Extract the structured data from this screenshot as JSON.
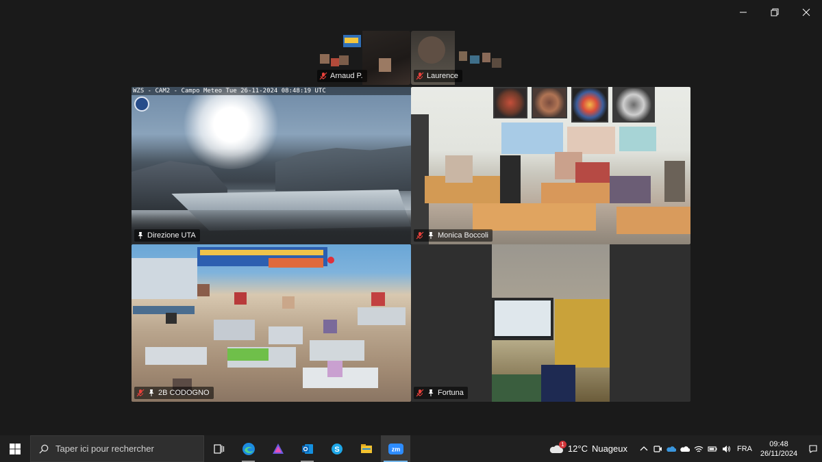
{
  "window": {
    "controls": [
      "minimize",
      "restore",
      "close"
    ]
  },
  "participants": {
    "strip": [
      {
        "name": "Arnaud P.",
        "muted": true
      },
      {
        "name": "Laurence",
        "muted": true
      }
    ],
    "grid": [
      {
        "name": "Direzione UTA",
        "muted": false,
        "pinned": true,
        "active_speaker": true,
        "overlay": "WZS - CAM2 - Campo Meteo Tue 26-11-2024 08:48:19 UTC"
      },
      {
        "name": "Monica Boccoli",
        "muted": true,
        "pinned": true
      },
      {
        "name": "2B CODOGNO",
        "muted": true,
        "pinned": true
      },
      {
        "name": "Fortuna",
        "muted": true,
        "pinned": true
      }
    ]
  },
  "taskbar": {
    "search_placeholder": "Taper ici pour rechercher",
    "apps": [
      "task-view",
      "edge",
      "copilot",
      "outlook",
      "skype",
      "file-explorer",
      "zoom"
    ],
    "weather": {
      "temp": "12°C",
      "condition": "Nuageux",
      "alert_badge": "1"
    },
    "language": "FRA",
    "time": "09:48",
    "date": "26/11/2024"
  },
  "colors": {
    "background": "#1a1a1a",
    "active_speaker_border": "#25c26e",
    "muted_icon": "#e8413b",
    "taskbar": "#202020"
  }
}
